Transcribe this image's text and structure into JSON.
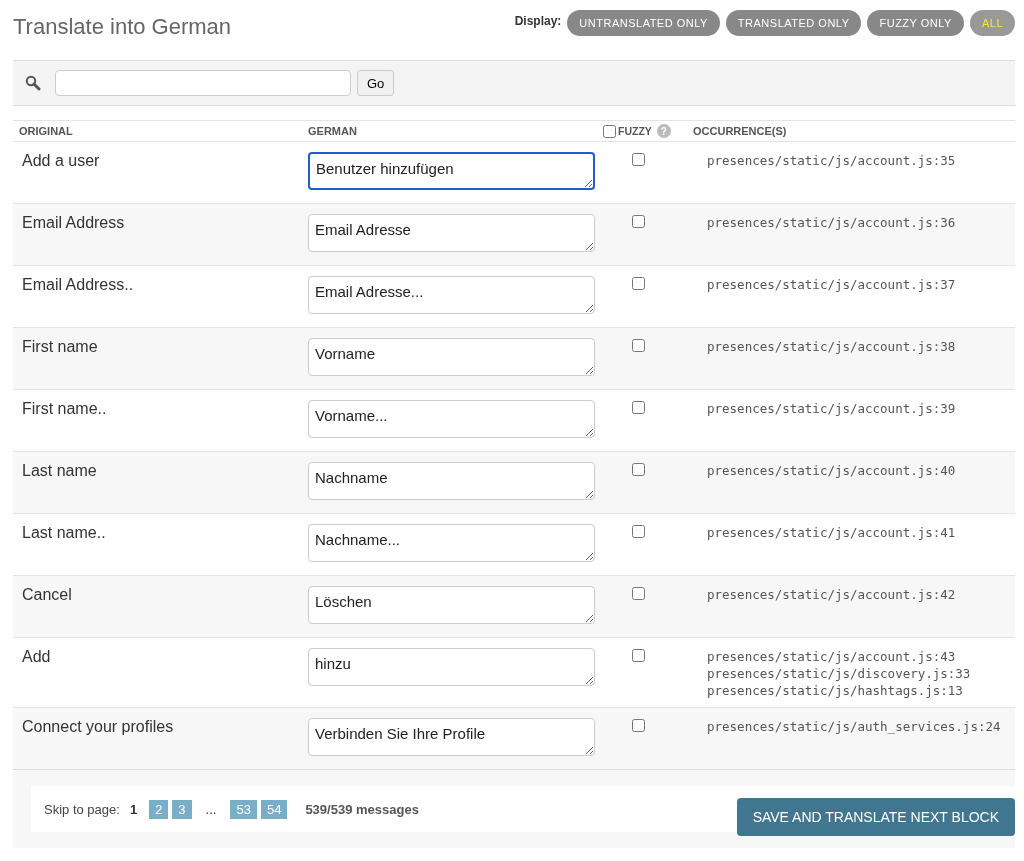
{
  "title": "Translate into German",
  "display": {
    "label": "Display:",
    "filters": [
      {
        "label": "UNTRANSLATED ONLY",
        "selected": false
      },
      {
        "label": "TRANSLATED ONLY",
        "selected": false
      },
      {
        "label": "FUZZY ONLY",
        "selected": false
      },
      {
        "label": "ALL",
        "selected": true
      }
    ]
  },
  "search": {
    "button": "Go"
  },
  "table": {
    "columns": {
      "original": "ORIGINAL",
      "translation": "GERMAN",
      "fuzzy": "FUZZY",
      "fuzzy_help": "?",
      "occurrences": "OCCURRENCE(S)"
    },
    "fuzzy_all_checked": false,
    "rows": [
      {
        "original": "Add a user",
        "translation": "Benutzer hinzufügen",
        "focused": true,
        "fuzzy": false,
        "occurrences": [
          "presences/static/js/account.js:35"
        ]
      },
      {
        "original": "Email Address",
        "translation": "Email Adresse",
        "focused": false,
        "fuzzy": false,
        "occurrences": [
          "presences/static/js/account.js:36"
        ]
      },
      {
        "original": "Email Address..",
        "translation": "Email Adresse...",
        "focused": false,
        "fuzzy": false,
        "occurrences": [
          "presences/static/js/account.js:37"
        ]
      },
      {
        "original": "First name",
        "translation": "Vorname",
        "focused": false,
        "fuzzy": false,
        "occurrences": [
          "presences/static/js/account.js:38"
        ]
      },
      {
        "original": "First name..",
        "translation": "Vorname...",
        "focused": false,
        "fuzzy": false,
        "occurrences": [
          "presences/static/js/account.js:39"
        ]
      },
      {
        "original": "Last name",
        "translation": "Nachname",
        "focused": false,
        "fuzzy": false,
        "occurrences": [
          "presences/static/js/account.js:40"
        ]
      },
      {
        "original": "Last name..",
        "translation": "Nachname...",
        "focused": false,
        "fuzzy": false,
        "occurrences": [
          "presences/static/js/account.js:41"
        ]
      },
      {
        "original": "Cancel",
        "translation": "Löschen",
        "focused": false,
        "fuzzy": false,
        "occurrences": [
          "presences/static/js/account.js:42"
        ]
      },
      {
        "original": "Add",
        "translation": "hinzu",
        "focused": false,
        "fuzzy": false,
        "occurrences": [
          "presences/static/js/account.js:43",
          "presences/static/js/discovery.js:33",
          "presences/static/js/hashtags.js:13"
        ]
      },
      {
        "original": "Connect your profiles",
        "translation": "Verbinden Sie Ihre Profile",
        "focused": false,
        "fuzzy": false,
        "occurrences": [
          "presences/static/js/auth_services.js:24"
        ]
      }
    ]
  },
  "pagination": {
    "label": "Skip to page:",
    "pages": [
      {
        "kind": "page",
        "label": "1",
        "selected": true
      },
      {
        "kind": "page",
        "label": "2",
        "selected": false
      },
      {
        "kind": "page",
        "label": "3",
        "selected": false
      },
      {
        "kind": "ellipsis",
        "label": "..."
      },
      {
        "kind": "page",
        "label": "53",
        "selected": false
      },
      {
        "kind": "page",
        "label": "54",
        "selected": false
      }
    ],
    "count": "539/539 messages"
  },
  "save_button": "SAVE AND TRANSLATE NEXT BLOCK"
}
